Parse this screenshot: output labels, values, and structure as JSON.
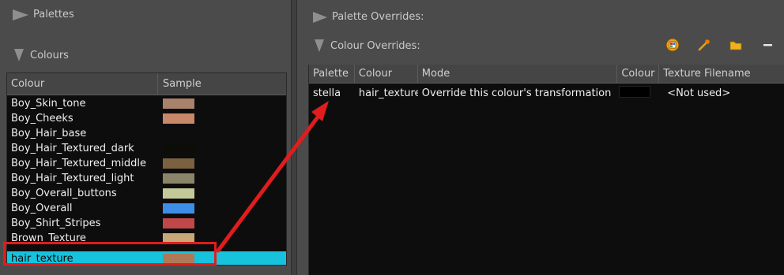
{
  "left_panel": {
    "palettes_label": "Palettes",
    "colours_label": "Colours",
    "list_header": {
      "colour": "Colour",
      "sample": "Sample"
    },
    "colours": [
      {
        "name": "Boy_Skin_tone",
        "swatch": "#a8826b"
      },
      {
        "name": "Boy_Cheeks",
        "swatch": "#c9886a"
      },
      {
        "name": "Boy_Hair_base",
        "swatch": ""
      },
      {
        "name": "Boy_Hair_Textured_dark",
        "swatch": "#0c0d08"
      },
      {
        "name": "Boy_Hair_Textured_middle",
        "swatch": "#7a6140"
      },
      {
        "name": "Boy_Hair_Textured_light",
        "swatch": "#8a8468"
      },
      {
        "name": "Boy_Overall_buttons",
        "swatch": "#c4c99a"
      },
      {
        "name": "Boy_Overall",
        "swatch": "#3d8ee8"
      },
      {
        "name": "Boy_Shirt_Stripes",
        "swatch": "#c04848"
      },
      {
        "name": "Brown_Texture",
        "swatch": "#c9a878"
      },
      {
        "name": "hair_texture",
        "swatch": "#b07a58"
      }
    ],
    "selected_colour": "hair_texture"
  },
  "right_panel": {
    "palette_overrides_label": "Palette Overrides:",
    "colour_overrides_label": "Colour Overrides:",
    "toolbar_icons": [
      "palette-override-icon",
      "pipette-icon",
      "folder-icon",
      "minus-icon"
    ],
    "table": {
      "headers": [
        "Palette",
        "Colour",
        "Mode",
        "Colour",
        "Texture Filename"
      ],
      "rows": [
        {
          "palette": "stella",
          "colour": "hair_texture",
          "mode": "Override this colour's transformation",
          "colour_swatch": "#000000",
          "texture": "<Not used>"
        }
      ]
    }
  },
  "colors": {
    "selection": "#17c2dd",
    "annotation": "#e01d1d",
    "list_bg": "#0d0d0d",
    "panel_bg": "#4b4b4b"
  }
}
